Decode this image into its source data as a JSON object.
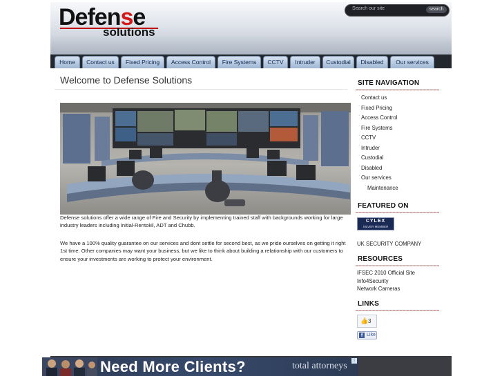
{
  "header": {
    "logo_top_pre": "Defen",
    "logo_top_red": "s",
    "logo_top_post": "e",
    "logo_bottom": "solutions",
    "search_placeholder": "Search our site",
    "search_button": "search"
  },
  "nav": {
    "tabs": [
      {
        "label": "Home"
      },
      {
        "label": "Contact us"
      },
      {
        "label": "Fixed Pricing"
      },
      {
        "label": "Access Control"
      },
      {
        "label": "Fire Systems"
      },
      {
        "label": "CCTV"
      },
      {
        "label": "Intruder"
      },
      {
        "label": "Custodial"
      },
      {
        "label": "Disabled"
      },
      {
        "label": "Our services"
      }
    ]
  },
  "main": {
    "title": "Welcome to Defense Solutions",
    "para1": "Defense solutions offer a wide range of Fire and Security by implementing trained staff with backgrounds working for large industry leaders including Initial-Rentokil, ADT and Chubb.",
    "para2": "We have a 100% quality guarantee on our services and dont settle for second best, as we pride ourselves on getting it right 1st time.  Other companies may want your business, but we like to think about building a relationship with our customers to ensure your investments are working to protect your environment."
  },
  "sidebar": {
    "nav_heading": "SITE NAVIGATION",
    "nav_items": [
      {
        "label": "Contact us"
      },
      {
        "label": "Fixed Pricing"
      },
      {
        "label": "Access Control"
      },
      {
        "label": "Fire Systems"
      },
      {
        "label": "CCTV"
      },
      {
        "label": "Intruder"
      },
      {
        "label": "Custodial"
      },
      {
        "label": "Disabled"
      },
      {
        "label": "Our services"
      },
      {
        "label": "Maintenance"
      }
    ],
    "featured_heading": "FEATURED ON",
    "featured_badge_top": "CYLEX",
    "featured_badge_bottom": "SILVER MEMBER",
    "featured_text": "UK SECURITY COMPANY",
    "resources_heading": "RESOURCES",
    "resources": [
      {
        "label": "IFSEC 2010 Official Site"
      },
      {
        "label": "Info4Security"
      },
      {
        "label": "Network Cameras"
      }
    ],
    "links_heading": "LINKS",
    "like_count": "3",
    "fb_like": "Like"
  },
  "ad": {
    "headline": "Need More Clients?",
    "brand": "total attorneys"
  },
  "colors": {
    "nav_bar": "#23272e",
    "accent_red": "#d11717",
    "tab_text": "#102a50"
  }
}
